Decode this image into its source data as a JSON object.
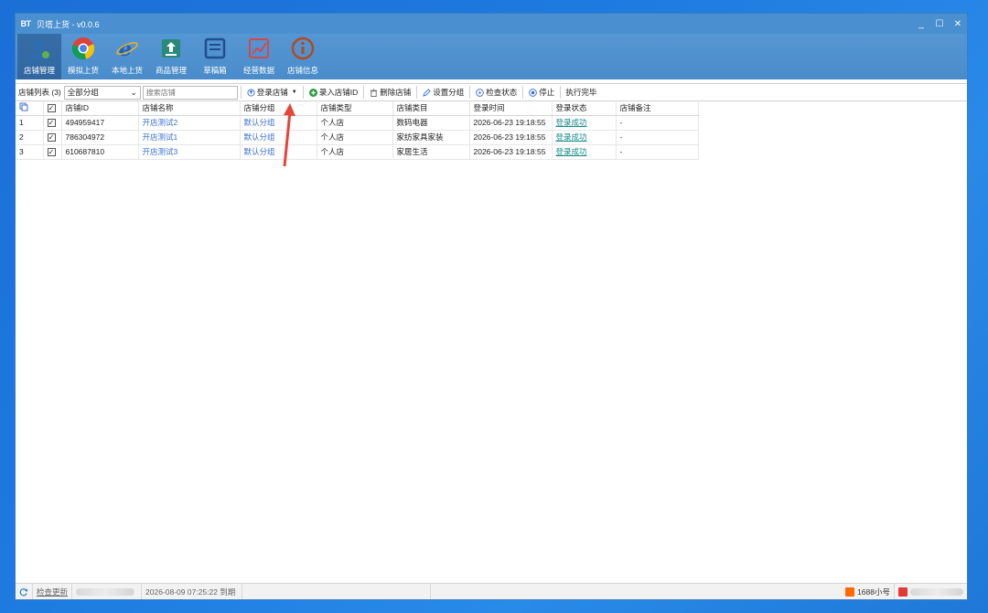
{
  "window": {
    "title": "贝塔上货 - v0.0.6",
    "logo_text": "BT"
  },
  "window_controls": [
    "_",
    "☐",
    "✕"
  ],
  "ribbon": {
    "items": [
      {
        "label": "店铺管理",
        "icon": "user-shop-icon",
        "active": true
      },
      {
        "label": "模拟上货",
        "icon": "chrome-icon"
      },
      {
        "label": "本地上货",
        "icon": "ie-icon"
      },
      {
        "label": "商品管理",
        "icon": "upload-box-icon"
      },
      {
        "label": "草稿箱",
        "icon": "draft-box-icon"
      },
      {
        "label": "经营数据",
        "icon": "chart-icon"
      },
      {
        "label": "店铺信息",
        "icon": "info-icon"
      }
    ]
  },
  "toolbar": {
    "store_list_label": "店铺列表 (3)",
    "group_select_value": "全部分组",
    "search_placeholder": "搜索店铺",
    "login_label": "登录店铺",
    "add_id_label": "录入店铺ID",
    "delete_label": "删除店铺",
    "set_group_label": "设置分组",
    "check_status_label": "检查状态",
    "stop_label": "停止",
    "status_text": "执行完毕"
  },
  "table": {
    "headers": [
      "店铺ID",
      "店铺名称",
      "店铺分组",
      "店铺类型",
      "店铺类目",
      "登录时间",
      "登录状态",
      "店铺备注"
    ],
    "rows": [
      {
        "num": "1",
        "id": "494959417",
        "name": "开店测试2",
        "group": "默认分组",
        "type": "个人店",
        "category": "数码电器",
        "time": "2026-06-23 19:18:55",
        "status": "登录成功",
        "note": "-"
      },
      {
        "num": "2",
        "id": "786304972",
        "name": "开店测试1",
        "group": "默认分组",
        "type": "个人店",
        "category": "家纺家具家装",
        "time": "2026-06-23 19:18:55",
        "status": "登录成功",
        "note": "-"
      },
      {
        "num": "3",
        "id": "610687810",
        "name": "开店测试3",
        "group": "默认分组",
        "type": "个人店",
        "category": "家居生活",
        "time": "2026-06-23 19:18:55",
        "status": "登录成功",
        "note": "-"
      }
    ]
  },
  "statusbar": {
    "check_update": "检查更新",
    "expiry": "2026-08-09 07:25:22 到期",
    "account_label": "1688小号"
  },
  "colors": {
    "title_bar": "#4a8fcf",
    "link_blue": "#3a6fd6",
    "link_green": "#178a8a",
    "arrow_red": "#e5453a"
  }
}
